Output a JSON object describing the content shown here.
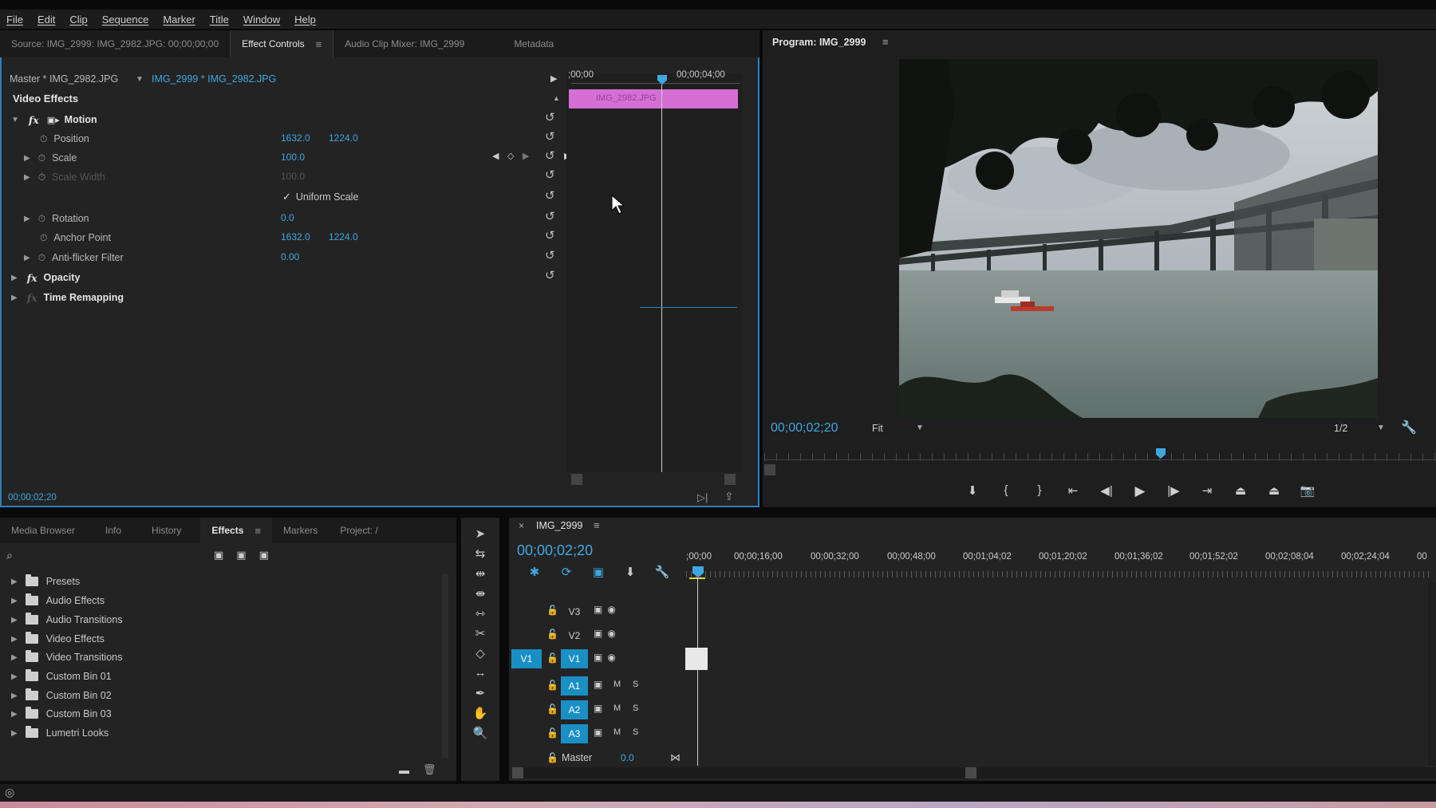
{
  "menu": [
    "File",
    "Edit",
    "Clip",
    "Sequence",
    "Marker",
    "Title",
    "Window",
    "Help"
  ],
  "effect_controls": {
    "tabs": [
      {
        "label": "Source: IMG_2999: IMG_2982.JPG: 00;00;00;00",
        "active": false
      },
      {
        "label": "Effect Controls",
        "active": true
      },
      {
        "label": "Audio Clip Mixer: IMG_2999",
        "active": false
      },
      {
        "label": "Metadata",
        "active": false
      }
    ],
    "master_label": "Master * IMG_2982.JPG",
    "clip_label": "IMG_2999 * IMG_2982.JPG",
    "section": "Video Effects",
    "motion": "Motion",
    "position_label": "Position",
    "position_x": "1632.0",
    "position_y": "1224.0",
    "scale_label": "Scale",
    "scale_value": "100.0",
    "scale_width_label": "Scale Width",
    "scale_width_value": "100.0",
    "uniform_scale": "Uniform Scale",
    "rotation_label": "Rotation",
    "rotation_value": "0.0",
    "anchor_label": "Anchor Point",
    "anchor_x": "1632.0",
    "anchor_y": "1224.0",
    "antiflicker_label": "Anti-flicker Filter",
    "antiflicker_value": "0.00",
    "opacity": "Opacity",
    "time_remap": "Time Remapping",
    "mini_tc_start": ";00;00",
    "mini_tc_end": "00;00;04;00",
    "mini_clip": "IMG_2982.JPG",
    "timecode": "00;00;02;20"
  },
  "program": {
    "title": "Program: IMG_2999",
    "timecode": "00;00;02;20",
    "fit": "Fit",
    "resolution": "1/2"
  },
  "effects_panel": {
    "tabs": [
      {
        "label": "Media Browser",
        "active": false
      },
      {
        "label": "Info",
        "active": false
      },
      {
        "label": "History",
        "active": false
      },
      {
        "label": "Effects",
        "active": true
      },
      {
        "label": "Markers",
        "active": false
      },
      {
        "label": "Project: /",
        "active": false
      }
    ],
    "items": [
      "Presets",
      "Audio Effects",
      "Audio Transitions",
      "Video Effects",
      "Video Transitions",
      "Custom Bin 01",
      "Custom Bin 02",
      "Custom Bin 03",
      "Lumetri Looks"
    ]
  },
  "timeline": {
    "title": "IMG_2999",
    "timecode": "00;00;02;20",
    "ruler": [
      ";00;00",
      "00;00;16;00",
      "00;00;32;00",
      "00;00;48;00",
      "00;01;04;02",
      "00;01;20;02",
      "00;01;36;02",
      "00;01;52;02",
      "00;02;08;04",
      "00;02;24;04",
      "00"
    ],
    "video_tracks": [
      "V3",
      "V2",
      "V1"
    ],
    "source_patch": "V1",
    "audio_tracks": [
      "A1",
      "A2",
      "A3"
    ],
    "m_label": "M",
    "s_label": "S",
    "master_label": "Master",
    "master_value": "0.0"
  },
  "colors": {
    "accent": "#3fa7e0",
    "clip_pink": "#d56fd6",
    "track_blue": "#1a8fc4"
  }
}
